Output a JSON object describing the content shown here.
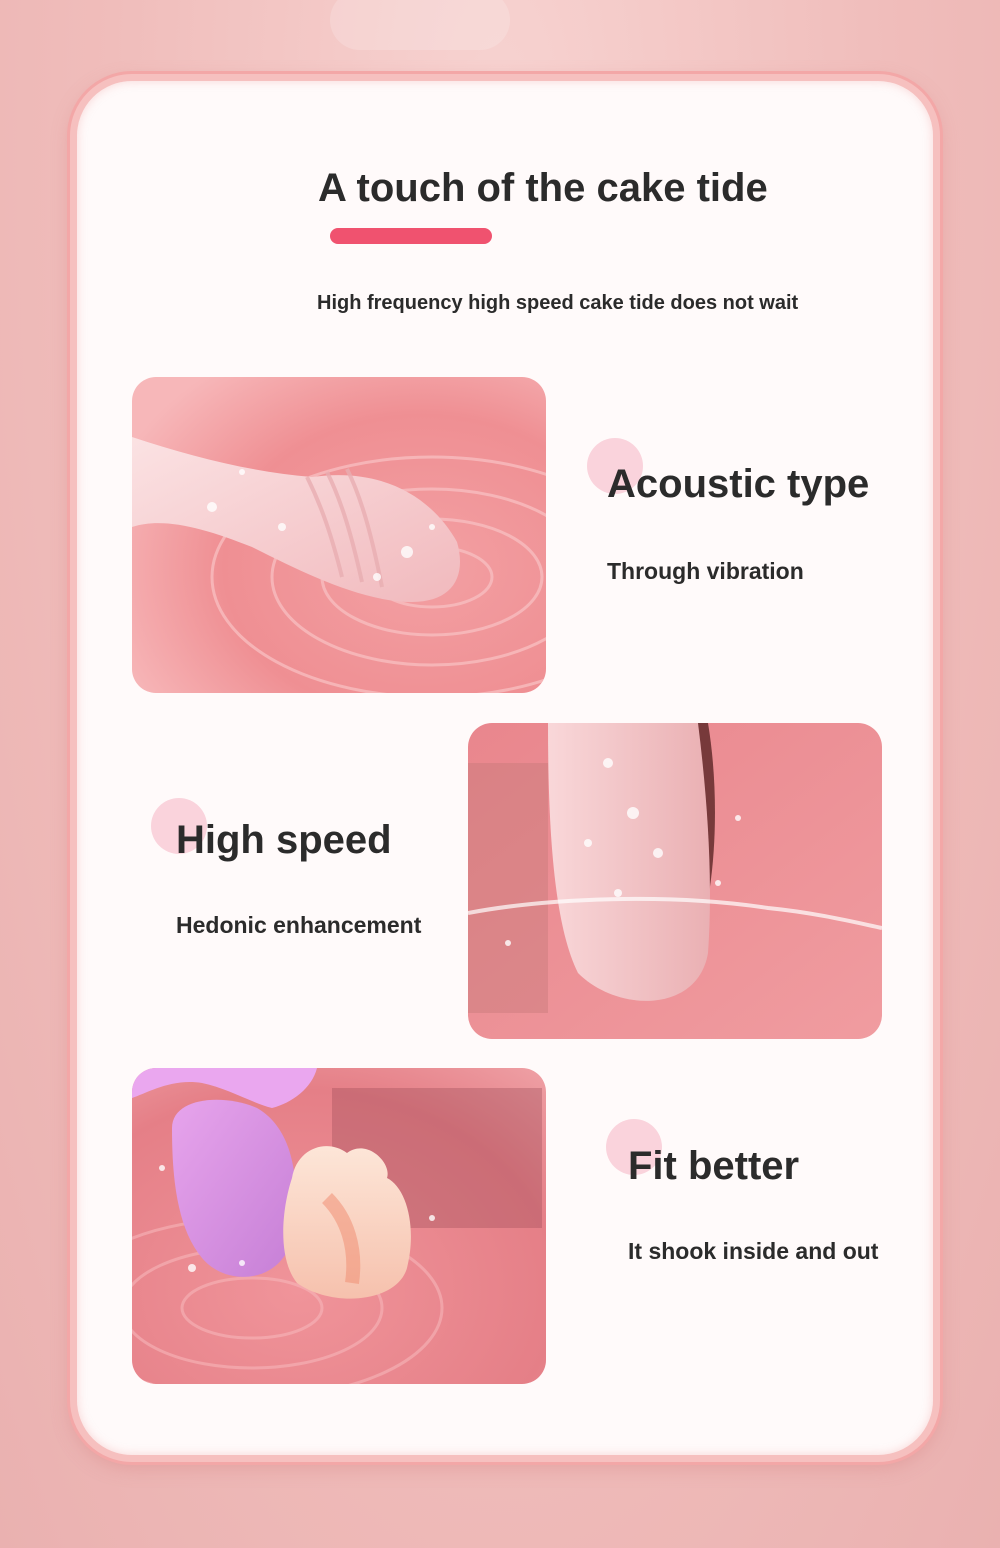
{
  "header": {
    "title": "A touch of the cake tide",
    "subtitle": "High frequency high speed cake tide does not wait"
  },
  "features": [
    {
      "title": "Acoustic type",
      "description": "Through vibration",
      "image": "pink-device-in-rippling-water-photo"
    },
    {
      "title": "High speed",
      "description": "Hedonic enhancement",
      "image": "pink-device-splashing-water-photo"
    },
    {
      "title": "Fit better",
      "description": "It shook inside and out",
      "image": "purple-device-with-jelly-dessert-photo"
    }
  ],
  "colors": {
    "accent": "#f0526f",
    "dot": "#fad3dc",
    "text": "#2b2b2b",
    "card_border": "#f6c0bf",
    "page_background": "#f0bdbb"
  }
}
